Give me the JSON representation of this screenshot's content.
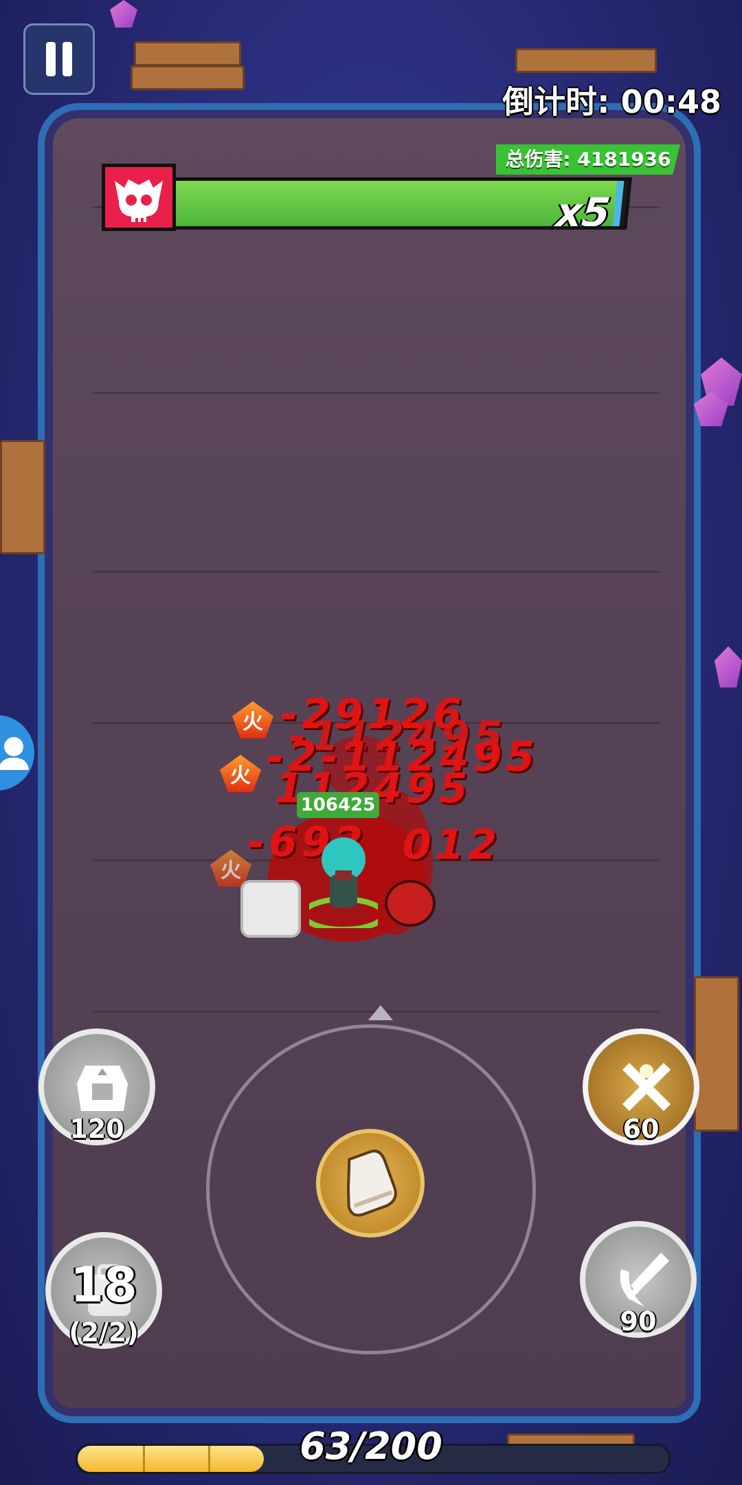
{
  "hud": {
    "countdown": "倒计时: 00:48",
    "total_damage": "总伤害: 4181936",
    "boss_multiplier": "x5",
    "boss_hp_fraction": 0.99,
    "pause_icon": "pause-icon"
  },
  "battle": {
    "player_hp_text": "106425",
    "fire_label": "火",
    "damage_numbers": [
      {
        "text": "-29126"
      },
      {
        "text": "-112495"
      },
      {
        "text": "-2-112495"
      },
      {
        "text": "112495"
      },
      {
        "text": "-692"
      },
      {
        "text": "012"
      }
    ]
  },
  "skills": {
    "top_left": {
      "count": "120",
      "icon": "armor-icon"
    },
    "top_right": {
      "count": "60",
      "icon": "crossed-swords-icon"
    },
    "bottom_left": {
      "count": "18",
      "sub": "(2/2)",
      "icon": "potion-bag-icon"
    },
    "bottom_right": {
      "count": "90",
      "icon": "sword-slash-icon"
    },
    "joystick_icon": "boot-icon"
  },
  "exp": {
    "text": "63/200",
    "fraction": 0.315
  }
}
